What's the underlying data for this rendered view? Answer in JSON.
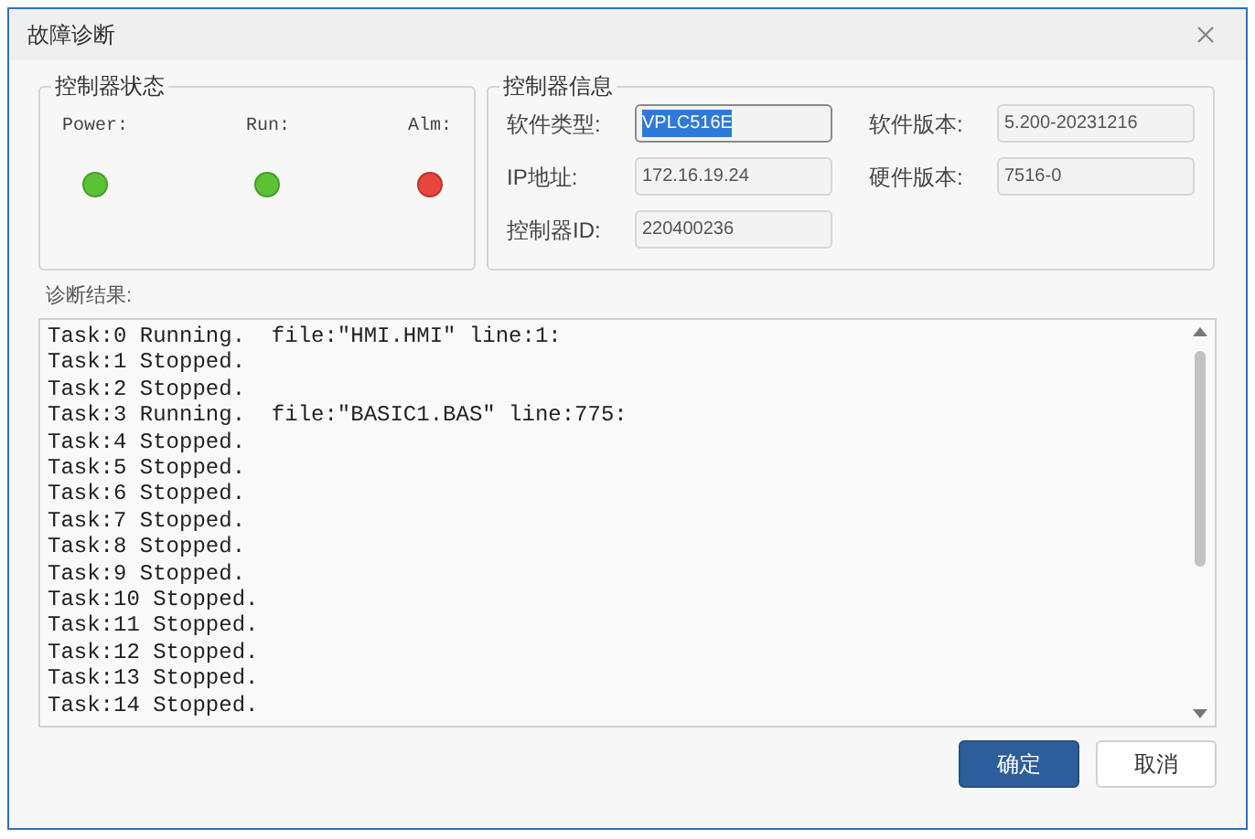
{
  "window": {
    "title": "故障诊断"
  },
  "status_group": {
    "title": "控制器状态",
    "indicators": [
      {
        "label": "Power:",
        "color": "#5cc235"
      },
      {
        "label": "Run:",
        "color": "#5cc235"
      },
      {
        "label": "Alm:",
        "color": "#e8453c"
      }
    ]
  },
  "info_group": {
    "title": "控制器信息",
    "fields": [
      {
        "label": "软件类型:",
        "value": "VPLC516E",
        "selected": true
      },
      {
        "label": "软件版本:",
        "value": "5.200-20231216",
        "selected": false
      },
      {
        "label": "IP地址:",
        "value": "172.16.19.24",
        "selected": false
      },
      {
        "label": "硬件版本:",
        "value": "7516-0",
        "selected": false
      },
      {
        "label": "控制器ID:",
        "value": "220400236",
        "selected": false
      }
    ]
  },
  "result": {
    "label": "诊断结果:",
    "lines": [
      "Task:0 Running.  file:\"HMI.HMI\" line:1:",
      "Task:1 Stopped.",
      "Task:2 Stopped.",
      "Task:3 Running.  file:\"BASIC1.BAS\" line:775:",
      "Task:4 Stopped.",
      "Task:5 Stopped.",
      "Task:6 Stopped.",
      "Task:7 Stopped.",
      "Task:8 Stopped.",
      "Task:9 Stopped.",
      "Task:10 Stopped.",
      "Task:11 Stopped.",
      "Task:12 Stopped.",
      "Task:13 Stopped.",
      "Task:14 Stopped."
    ]
  },
  "buttons": [
    {
      "label": "确定",
      "kind": "primary"
    },
    {
      "label": "取消",
      "kind": "secondary"
    }
  ]
}
